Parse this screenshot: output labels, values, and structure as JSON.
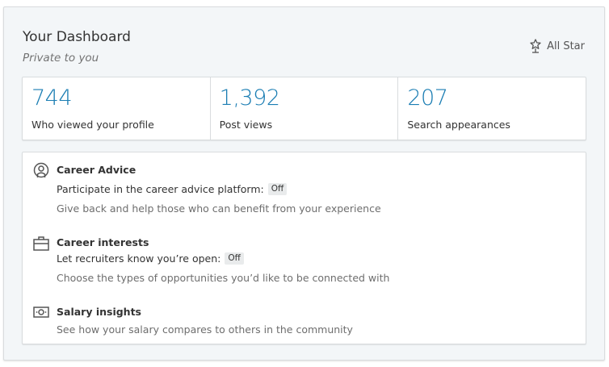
{
  "dashboard": {
    "title": "Your Dashboard",
    "subtitle": "Private to you",
    "badge_label": "All Star",
    "badge_icon": "all-star-icon"
  },
  "stats": [
    {
      "value": "744",
      "label": "Who viewed your profile"
    },
    {
      "value": "1,392",
      "label": "Post views"
    },
    {
      "value": "207",
      "label": "Search appearances"
    }
  ],
  "settings": {
    "career_advice": {
      "icon": "career-advice-icon",
      "title": "Career Advice",
      "line": "Participate in the career advice platform:",
      "status": "Off",
      "description": "Give back and help those who can benefit from your experience"
    },
    "career_interests": {
      "icon": "briefcase-icon",
      "title": "Career interests",
      "line": "Let recruiters know you’re open:",
      "status": "Off",
      "description": "Choose the types of opportunities you’d like to be connected with"
    },
    "salary_insights": {
      "icon": "money-icon",
      "title": "Salary insights",
      "description": "See how your salary compares to others in the community"
    }
  },
  "colors": {
    "accent": "#1a7db3",
    "background": "#f3f6f8"
  }
}
